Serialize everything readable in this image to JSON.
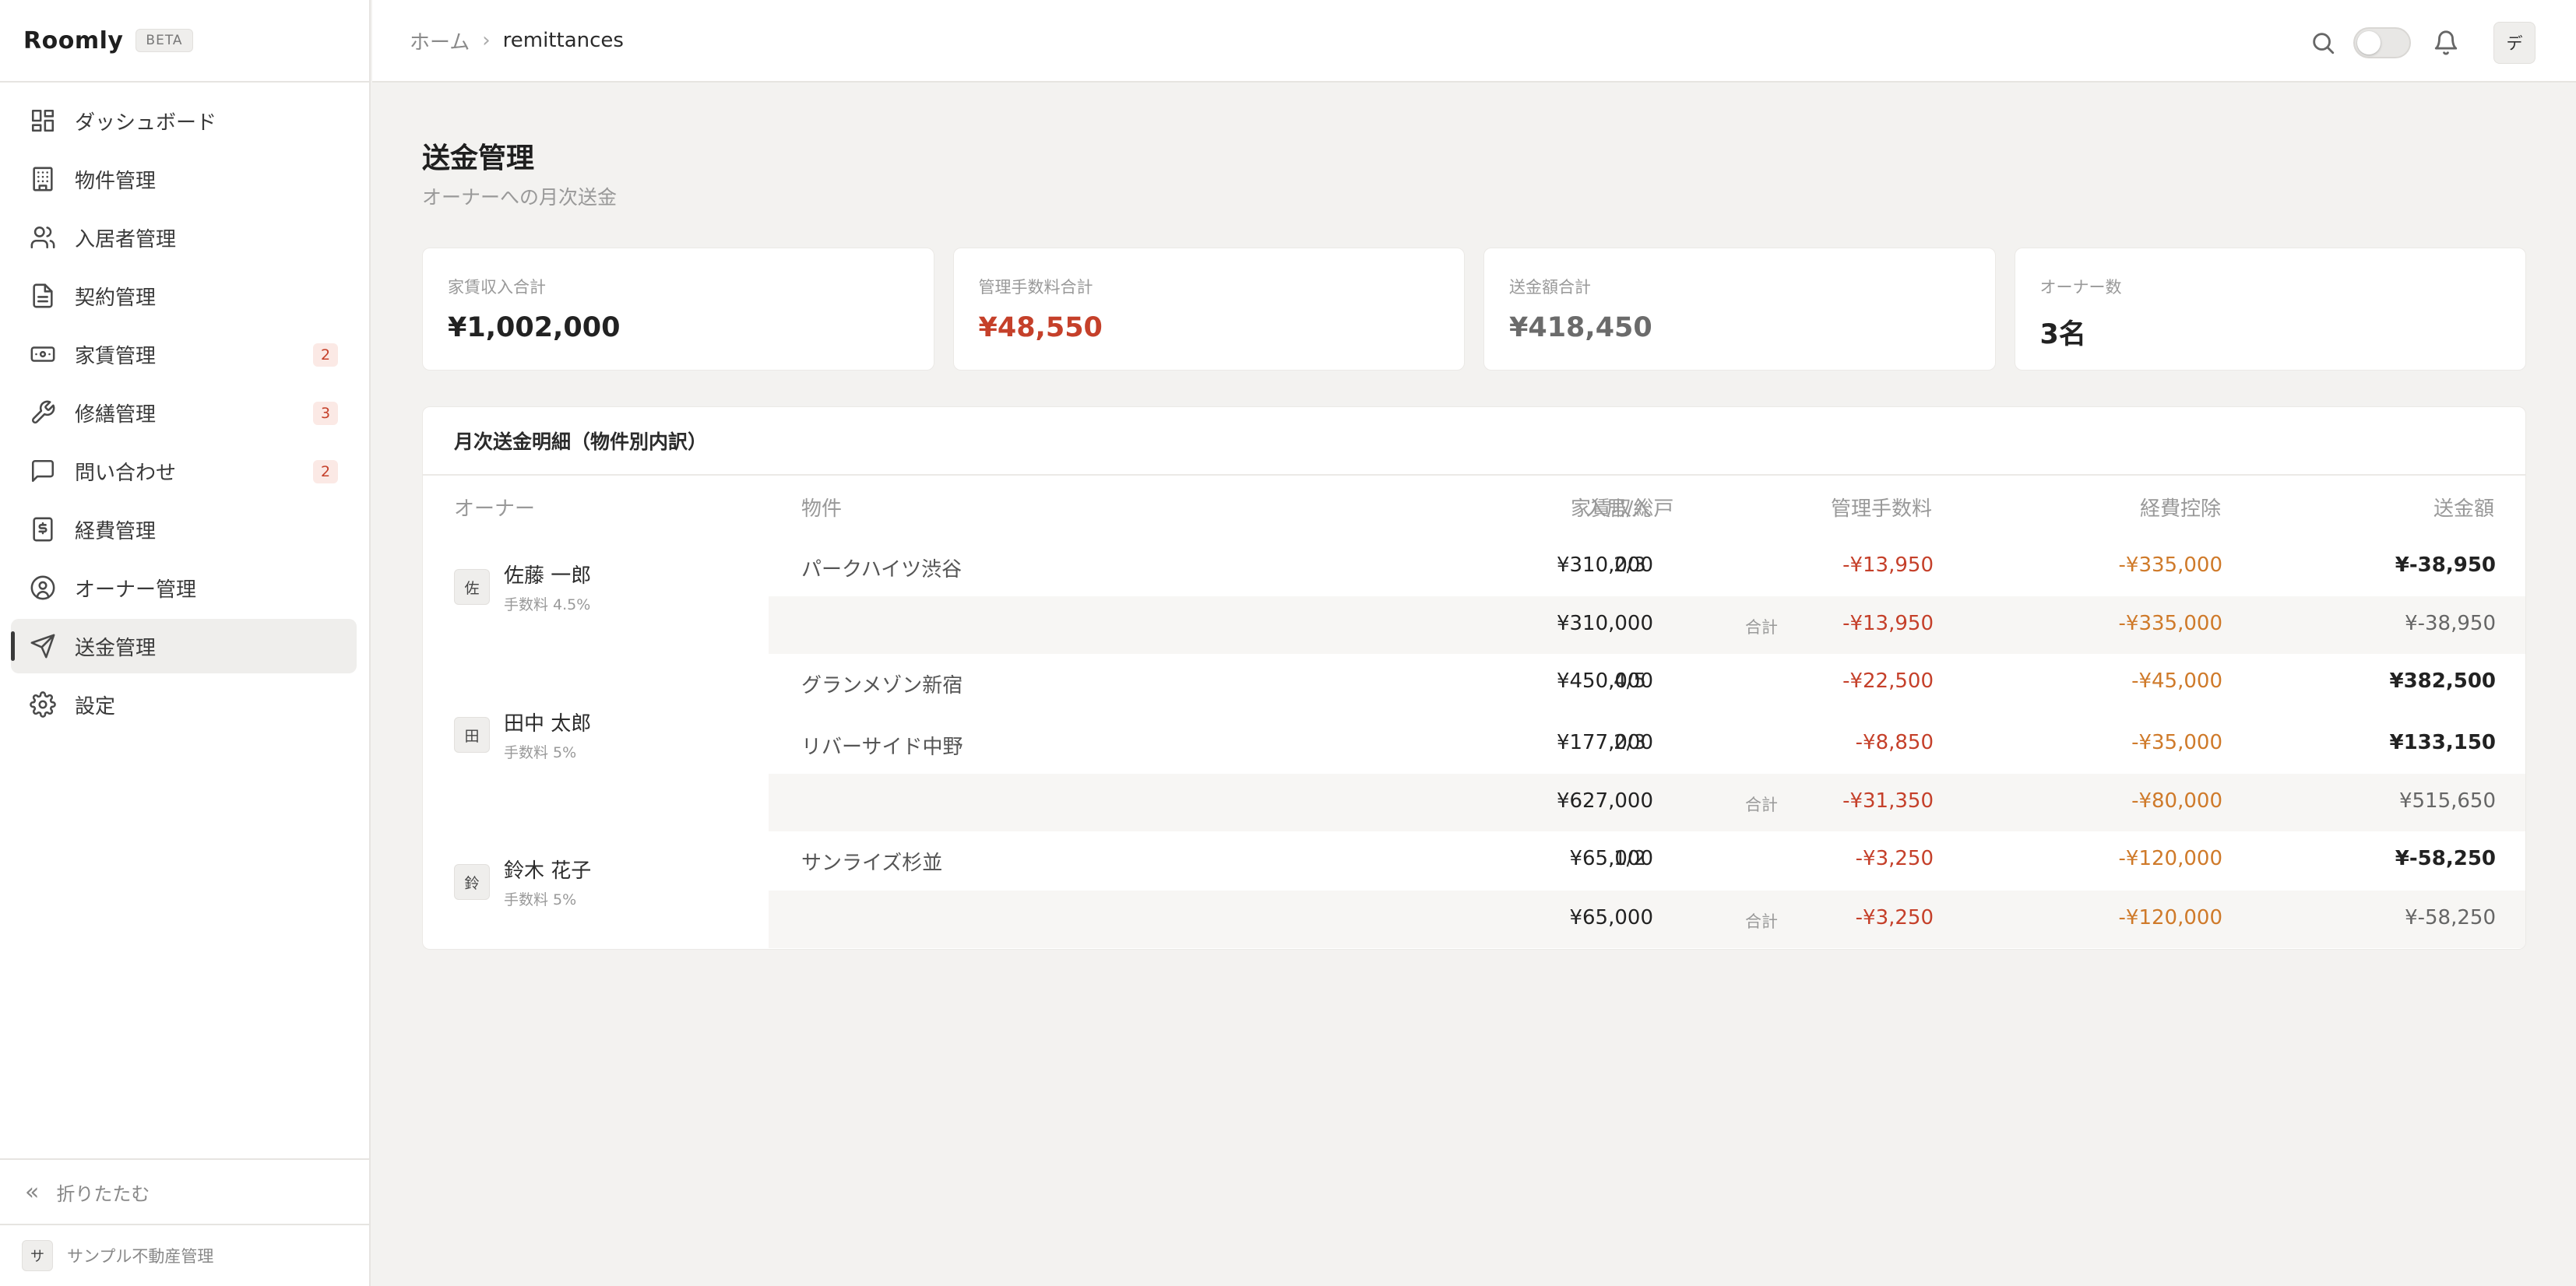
{
  "app": {
    "name": "Roomly",
    "badge": "BETA"
  },
  "sidebar": {
    "items": [
      {
        "label": "ダッシュボード",
        "icon": "dashboard-icon"
      },
      {
        "label": "物件管理",
        "icon": "building-icon"
      },
      {
        "label": "入居者管理",
        "icon": "users-icon"
      },
      {
        "label": "契約管理",
        "icon": "document-icon"
      },
      {
        "label": "家賃管理",
        "icon": "banknote-icon",
        "badge": "2"
      },
      {
        "label": "修繕管理",
        "icon": "wrench-icon",
        "badge": "3"
      },
      {
        "label": "問い合わせ",
        "icon": "message-icon",
        "badge": "2"
      },
      {
        "label": "経費管理",
        "icon": "receipt-icon"
      },
      {
        "label": "オーナー管理",
        "icon": "user-circle-icon"
      },
      {
        "label": "送金管理",
        "icon": "send-icon",
        "active": true
      },
      {
        "label": "設定",
        "icon": "gear-icon"
      }
    ],
    "collapse_label": "折りたたむ",
    "org": {
      "avatar": "サ",
      "name": "サンプル不動産管理"
    }
  },
  "header": {
    "breadcrumb_home": "ホーム",
    "breadcrumb_current": "remittances",
    "user_avatar": "デ"
  },
  "page": {
    "title": "送金管理",
    "subtitle": "オーナーへの月次送金"
  },
  "stats": [
    {
      "label": "家賃収入合計",
      "value": "¥1,002,000",
      "color": "#222222"
    },
    {
      "label": "管理手数料合計",
      "value": "¥48,550",
      "color": "#c5402a"
    },
    {
      "label": "送金額合計",
      "value": "¥418,450",
      "color": "#6b6b6b"
    },
    {
      "label": "オーナー数",
      "value": "3名",
      "color": "#222222"
    }
  ],
  "table": {
    "title": "月次送金明細（物件別内訳）",
    "headers": {
      "owner": "オーナー",
      "property": "物件",
      "occupancy": "入居/総戸",
      "rent": "家賃収入",
      "fee": "管理手数料",
      "expense": "経費控除",
      "remit": "送金額"
    },
    "total_label": "合計",
    "owners": [
      {
        "avatar": "佐",
        "name": "佐藤 一郎",
        "fee_rate": "手数料 4.5%",
        "properties": [
          {
            "name": "パークハイツ渋谷",
            "occupancy": "2/3",
            "rent": "¥310,000",
            "fee": "-¥13,950",
            "expense": "-¥335,000",
            "remit": "¥-38,950"
          }
        ],
        "total": {
          "rent": "¥310,000",
          "fee": "-¥13,950",
          "expense": "-¥335,000",
          "remit": "¥-38,950"
        }
      },
      {
        "avatar": "田",
        "name": "田中 太郎",
        "fee_rate": "手数料 5%",
        "properties": [
          {
            "name": "グランメゾン新宿",
            "occupancy": "4/5",
            "rent": "¥450,000",
            "fee": "-¥22,500",
            "expense": "-¥45,000",
            "remit": "¥382,500"
          },
          {
            "name": "リバーサイド中野",
            "occupancy": "2/3",
            "rent": "¥177,000",
            "fee": "-¥8,850",
            "expense": "-¥35,000",
            "remit": "¥133,150"
          }
        ],
        "total": {
          "rent": "¥627,000",
          "fee": "-¥31,350",
          "expense": "-¥80,000",
          "remit": "¥515,650"
        }
      },
      {
        "avatar": "鈴",
        "name": "鈴木 花子",
        "fee_rate": "手数料 5%",
        "properties": [
          {
            "name": "サンライズ杉並",
            "occupancy": "1/2",
            "rent": "¥65,000",
            "fee": "-¥3,250",
            "expense": "-¥120,000",
            "remit": "¥-58,250"
          }
        ],
        "total": {
          "rent": "¥65,000",
          "fee": "-¥3,250",
          "expense": "-¥120,000",
          "remit": "¥-58,250"
        }
      }
    ]
  }
}
